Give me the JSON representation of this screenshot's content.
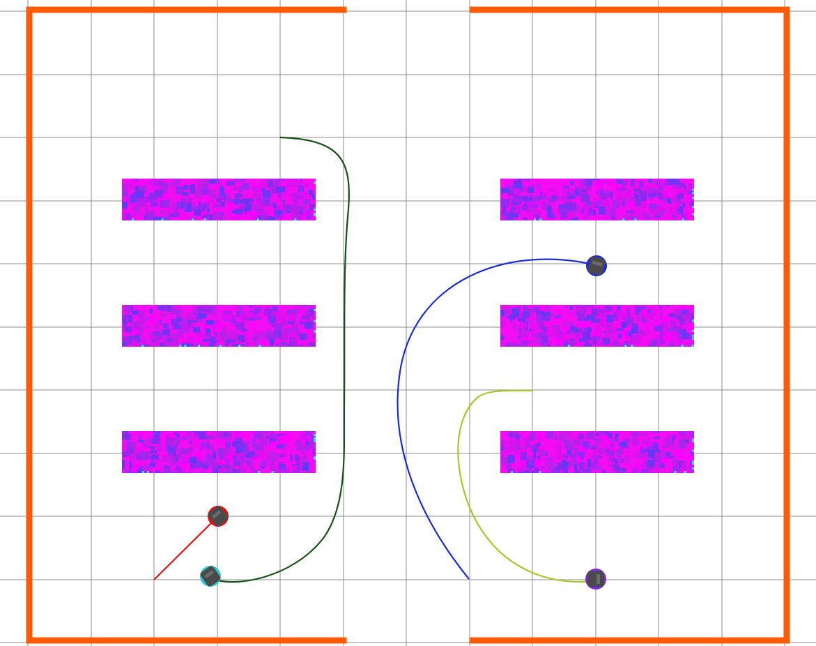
{
  "colors": {
    "background": "#ffffff",
    "grid": "#8c8c8c",
    "wall": "#ff5a06",
    "shelf_base": "#f20df2",
    "shelf_noise": [
      "#ff00ff",
      "#e010f0",
      "#b81fea",
      "#7a2ff0",
      "#5a3cf5",
      "#c020e8",
      "#9d2af0"
    ],
    "shelf_edge": "#2ee0f0",
    "robot_body": "#4a4a4a"
  },
  "map": {
    "wall_segments_count": 4,
    "shelf_count": 6
  },
  "robots": [
    {
      "id": "robot-red",
      "color": "#e81010",
      "path_color": "#e81010"
    },
    {
      "id": "robot-cyan",
      "color": "#28c8d0",
      "path_color": "#145214"
    },
    {
      "id": "robot-blue",
      "color": "#1a2ae0",
      "path_color": "#1a2ae0"
    },
    {
      "id": "robot-purple",
      "color": "#7a2ad8",
      "path_color": "#a8c828"
    }
  ]
}
